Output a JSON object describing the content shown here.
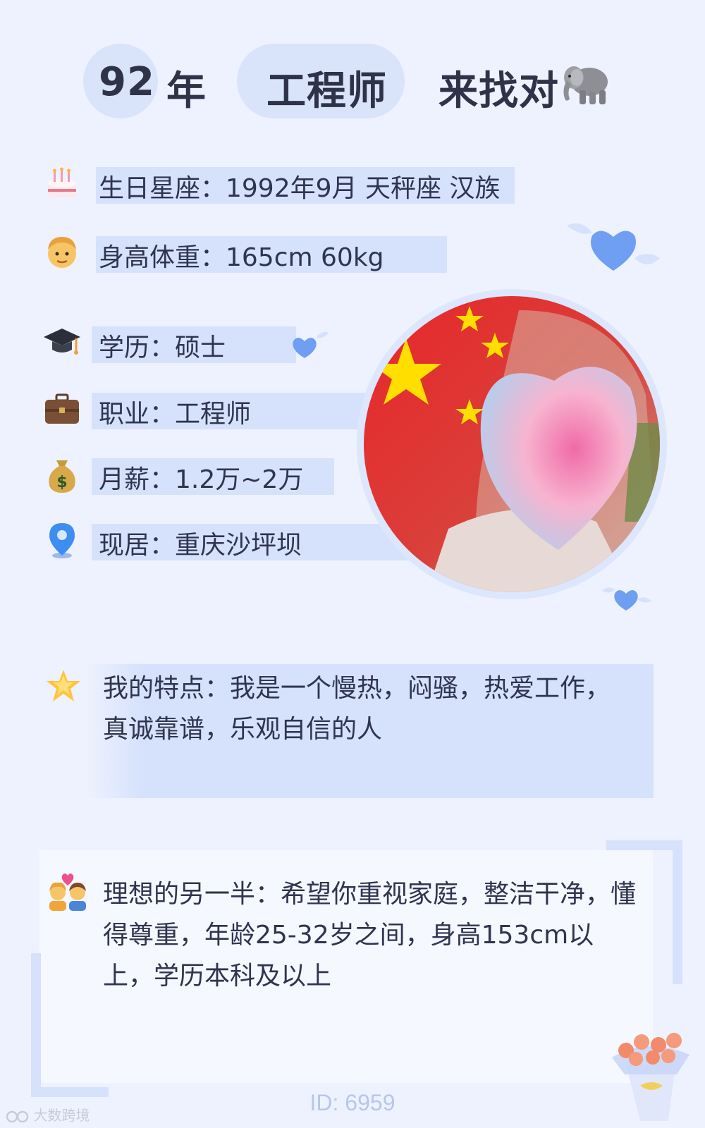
{
  "header": {
    "age": "92",
    "age_unit": "年",
    "occupation": "工程师",
    "tagline": "来找对",
    "tag_icon": "elephant-icon"
  },
  "info": [
    {
      "icon": "birthday-cake-icon",
      "text": "生日星座：1992年9月 天秤座 汉族"
    },
    {
      "icon": "man-face-icon",
      "text": "身高体重：165cm 60kg"
    },
    {
      "icon": "graduation-cap-icon",
      "text": "学历：硕士"
    },
    {
      "icon": "briefcase-icon",
      "text": "职业：工程师"
    },
    {
      "icon": "money-bag-icon",
      "text": "月薪：1.2万~2万"
    },
    {
      "icon": "location-pin-icon",
      "text": "现居：重庆沙坪坝"
    }
  ],
  "traits": {
    "icon": "star-icon",
    "text": "我的特点：我是一个慢热，闷骚，热爱工作，真诚靠谱，乐观自信的人"
  },
  "ideal": {
    "icon": "couple-heart-icon",
    "text": "理想的另一半：希望你重视家庭，整洁干净，懂得尊重，年龄25-32岁之间，身高153cm以上，学历本科及以上"
  },
  "footer": {
    "id_text": "ID: 6959",
    "watermark": "大数跨境"
  },
  "colors": {
    "background": "#eef2fe",
    "highlight": "#d6e2fc",
    "heart_blue": "#6f9ff2",
    "text": "#2f3450"
  }
}
